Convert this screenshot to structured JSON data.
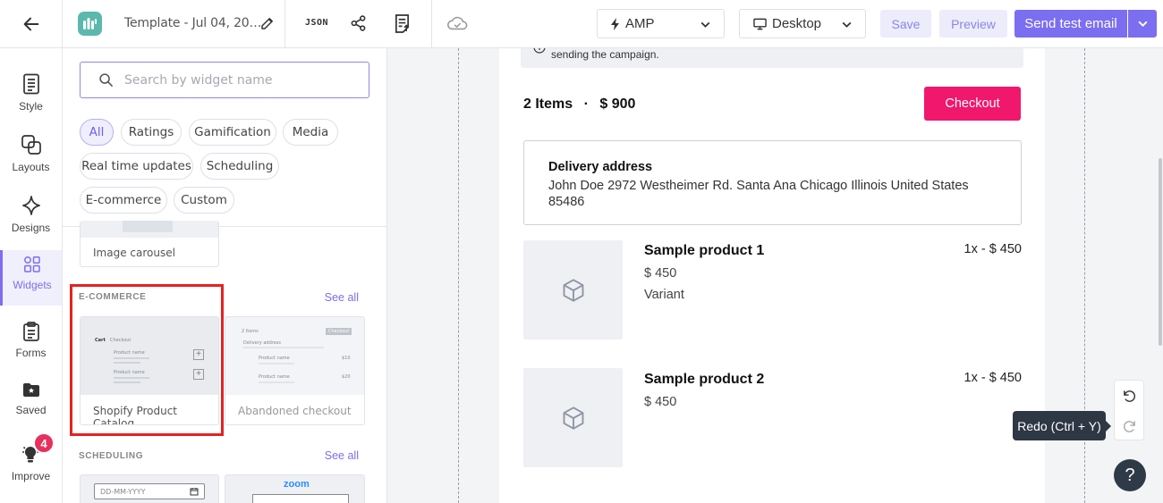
{
  "header": {
    "back_icon": "arrow-left-icon",
    "logo_icon": "app-logo-icon",
    "template_title": "Template - Jul 04, 20…",
    "json_label": "JSON",
    "version_select": "AMP",
    "device_select": "Desktop",
    "save_label": "Save",
    "preview_label": "Preview",
    "send_label": "Send test email",
    "accent_color": "#7b6ef0"
  },
  "rail": {
    "items": [
      {
        "label": "Style",
        "icon": "document-icon"
      },
      {
        "label": "Layouts",
        "icon": "layouts-icon"
      },
      {
        "label": "Designs",
        "icon": "sparkle-icon"
      },
      {
        "label": "Widgets",
        "icon": "widgets-icon",
        "active": true
      },
      {
        "label": "Forms",
        "icon": "forms-icon"
      },
      {
        "label": "Saved",
        "icon": "folder-icon"
      },
      {
        "label": "Improve",
        "icon": "bulb-icon"
      }
    ],
    "improve_badge": "4"
  },
  "widgets_panel": {
    "search_placeholder": "Search by widget name",
    "filters": [
      "All",
      "Ratings",
      "Gamification",
      "Media",
      "Real time updates",
      "Scheduling",
      "E-commerce",
      "Custom"
    ],
    "active_filter": "All",
    "carousel_label": "Image carousel",
    "ecommerce": {
      "title": "E-COMMERCE",
      "see_all": "See all",
      "cards": [
        {
          "label": "Shopify Product Catalog",
          "selected": true
        },
        {
          "label": "Abandoned checkout"
        }
      ],
      "thumb_cart": "Cart",
      "thumb_checkout": "Checkout",
      "thumb_product": "Product name",
      "thumb_items": "2 Items",
      "thumb_checkout_btn": "Checkout",
      "thumb_delivery": "Delivery address",
      "thumb_price_1": "$10",
      "thumb_price_2": "$20"
    },
    "scheduling": {
      "title": "SCHEDULING",
      "see_all": "See all",
      "date_placeholder": "DD-MM-YYYY",
      "zoom_label": "zoom"
    }
  },
  "email": {
    "notice": "sending the campaign.",
    "items_count": "2 Items",
    "dot": "·",
    "total": "$ 900",
    "checkout_label": "Checkout",
    "checkout_color": "#f0176d",
    "address_title": "Delivery address",
    "address": "John Doe 2972 Westheimer Rd. Santa Ana Chicago Illinois United States 85486",
    "products": [
      {
        "name": "Sample product 1",
        "price": "$ 450",
        "variant": "Variant",
        "qty": "1x - $ 450"
      },
      {
        "name": "Sample product 2",
        "price": "$ 450",
        "qty": "1x - $ 450"
      }
    ]
  },
  "canvas_tools": {
    "tooltip": "Redo (Ctrl + Y)",
    "help": "?"
  }
}
